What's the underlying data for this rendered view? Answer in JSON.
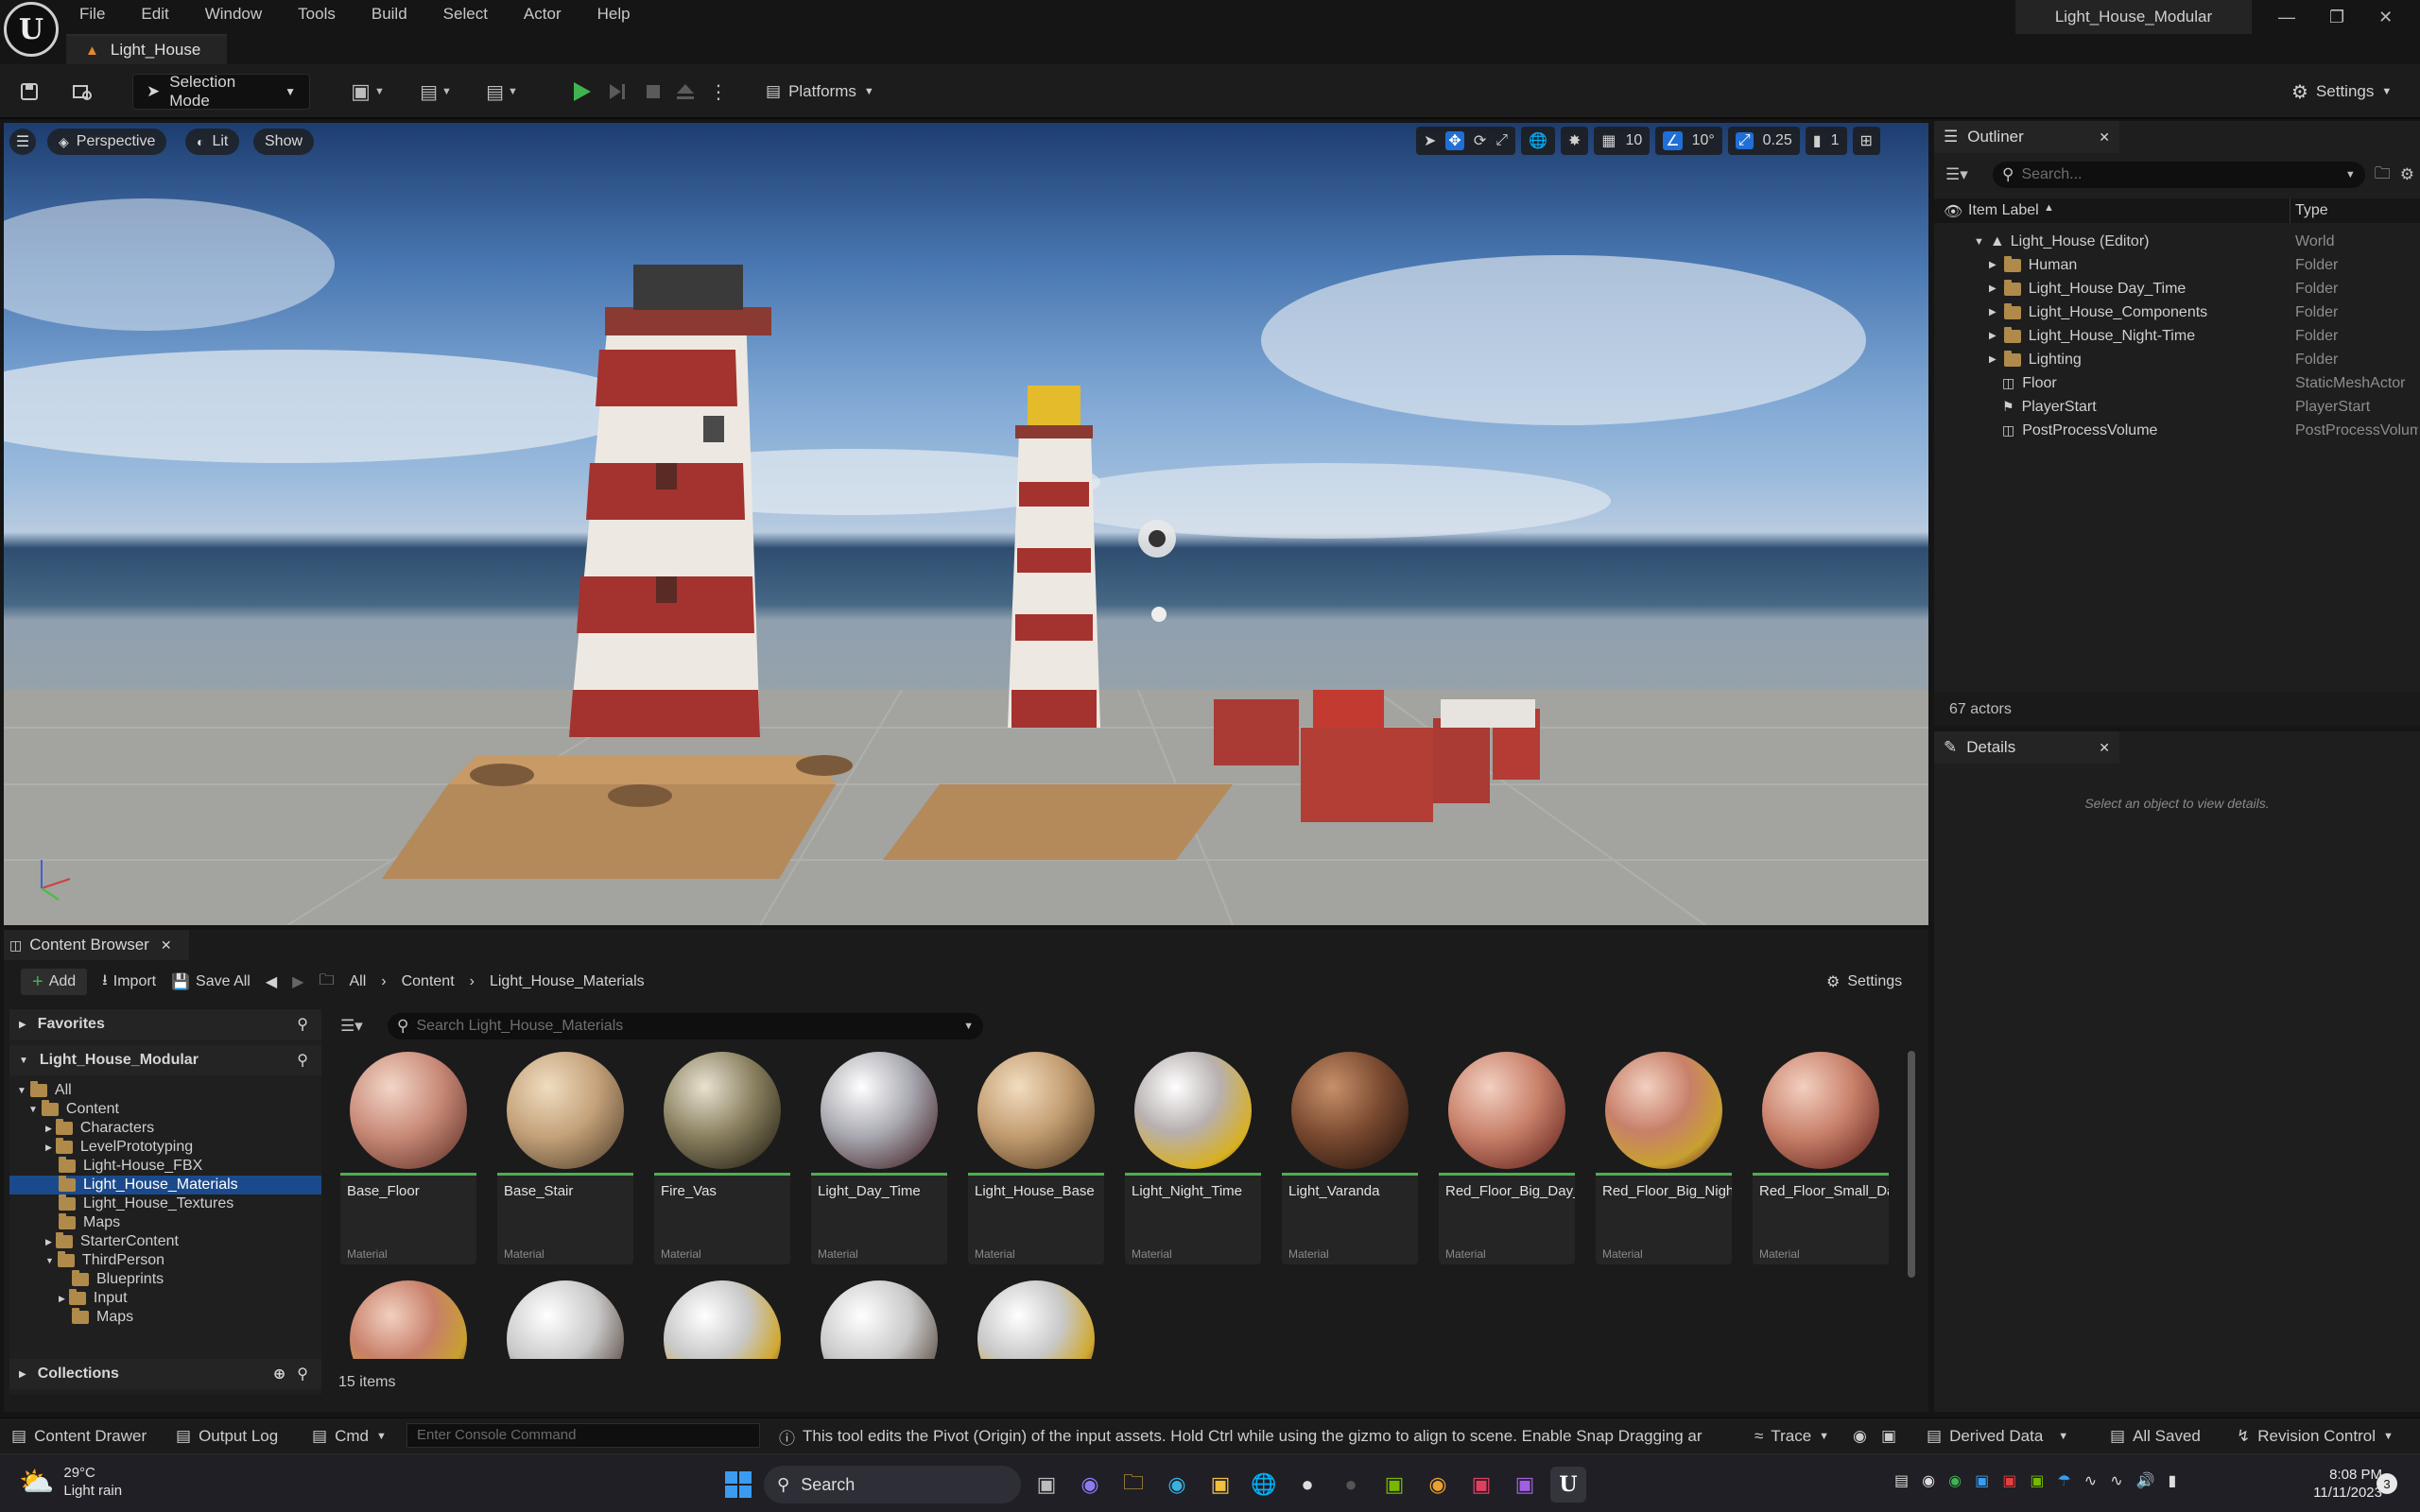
{
  "menu": [
    "File",
    "Edit",
    "Window",
    "Tools",
    "Build",
    "Select",
    "Actor",
    "Help"
  ],
  "window_title": "Light_House_Modular",
  "document_tab": "Light_House",
  "toolbar": {
    "selection_mode": "Selection Mode",
    "platforms": "Platforms",
    "settings": "Settings"
  },
  "viewport": {
    "perspective": "Perspective",
    "lit": "Lit",
    "show": "Show",
    "grid_snap": "10",
    "rotation_snap": "10°",
    "scale_snap": "0.25",
    "camera_speed": "1"
  },
  "outliner": {
    "title": "Outliner",
    "search_placeholder": "Search...",
    "col_label": "Item Label",
    "col_type": "Type",
    "items": [
      {
        "label": "Light_House (Editor)",
        "type": "World"
      },
      {
        "label": "Human",
        "type": "Folder"
      },
      {
        "label": "Light_House Day_Time",
        "type": "Folder"
      },
      {
        "label": "Light_House_Components",
        "type": "Folder"
      },
      {
        "label": "Light_House_Night-Time",
        "type": "Folder"
      },
      {
        "label": "Lighting",
        "type": "Folder"
      },
      {
        "label": "Floor",
        "type": "StaticMeshActor"
      },
      {
        "label": "PlayerStart",
        "type": "PlayerStart"
      },
      {
        "label": "PostProcessVolume",
        "type": "PostProcessVolume"
      }
    ],
    "actor_count": "67 actors"
  },
  "details": {
    "title": "Details",
    "empty_text": "Select an object to view details."
  },
  "content_browser": {
    "title": "Content Browser",
    "add": "Add",
    "import": "Import",
    "save_all": "Save All",
    "breadcrumb": [
      "All",
      "Content",
      "Light_House_Materials"
    ],
    "settings": "Settings",
    "favorites": "Favorites",
    "project": "Light_House_Modular",
    "search_placeholder": "Search Light_House_Materials",
    "tree": [
      {
        "label": "All",
        "level": 0
      },
      {
        "label": "Content",
        "level": 1
      },
      {
        "label": "Characters",
        "level": 2
      },
      {
        "label": "LevelPrototyping",
        "level": 2
      },
      {
        "label": "Light-House_FBX",
        "level": 2
      },
      {
        "label": "Light_House_Materials",
        "level": 2
      },
      {
        "label": "Light_House_Textures",
        "level": 2
      },
      {
        "label": "Maps",
        "level": 2
      },
      {
        "label": "StarterContent",
        "level": 2
      },
      {
        "label": "ThirdPerson",
        "level": 2
      },
      {
        "label": "Blueprints",
        "level": 3
      },
      {
        "label": "Input",
        "level": 3
      },
      {
        "label": "Maps",
        "level": 3
      }
    ],
    "collections": "Collections",
    "assets": [
      {
        "name": "Base_Floor",
        "type": "Material"
      },
      {
        "name": "Base_Stair",
        "type": "Material"
      },
      {
        "name": "Fire_Vas",
        "type": "Material"
      },
      {
        "name": "Light_Day_Time",
        "type": "Material"
      },
      {
        "name": "Light_House_Base",
        "type": "Material"
      },
      {
        "name": "Light_Night_Time",
        "type": "Material"
      },
      {
        "name": "Light_Varanda",
        "type": "Material"
      },
      {
        "name": "Red_Floor_Big_Day_Time",
        "type": "Material"
      },
      {
        "name": "Red_Floor_Big_Night_Time",
        "type": "Material"
      },
      {
        "name": "Red_Floor_Small_Day_Time",
        "type": "Material"
      }
    ],
    "item_count": "15 items"
  },
  "statusbar": {
    "content_drawer": "Content Drawer",
    "output_log": "Output Log",
    "cmd": "Cmd",
    "console_placeholder": "Enter Console Command",
    "hint": "This tool edits the Pivot (Origin) of the input assets. Hold Ctrl while using the gizmo to align to scene. Enable Snap Dragging ar",
    "trace": "Trace",
    "derived_data": "Derived Data",
    "all_saved": "All Saved",
    "revision_control": "Revision Control"
  },
  "taskbar": {
    "weather_temp": "29°C",
    "weather_desc": "Light rain",
    "search": "Search",
    "time": "8:08 PM",
    "date": "11/11/2023",
    "notif": "3"
  },
  "colors": {
    "accent_blue": "#1f6fd6",
    "play_green": "#3fb34f",
    "selected_row": "#1b4a8c",
    "folder": "#b08a4a"
  }
}
